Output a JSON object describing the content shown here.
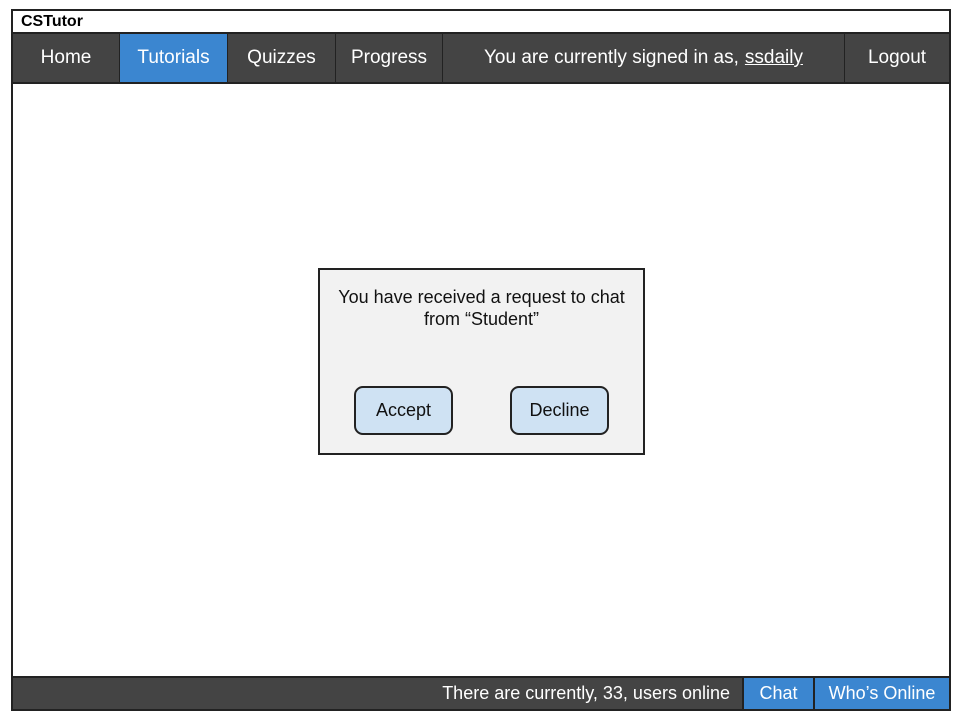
{
  "app": {
    "title": "CSTutor"
  },
  "nav": {
    "items": [
      {
        "label": "Home"
      },
      {
        "label": "Tutorials",
        "active": true
      },
      {
        "label": "Quizzes"
      },
      {
        "label": "Progress"
      }
    ],
    "signed_in_prefix": "You are currently signed in as,",
    "username": "ssdaily",
    "logout_label": "Logout"
  },
  "dialog": {
    "message": "You have received a request to chat from “Student”",
    "accept_label": "Accept",
    "decline_label": "Decline"
  },
  "footer": {
    "status_text": "There are currently, 33, users online",
    "chat_label": "Chat",
    "whos_online_label": "Who’s Online"
  },
  "colors": {
    "nav_background": "#444444",
    "active_accent": "#3b86d0",
    "button_fill": "#cfe2f3",
    "dialog_background": "#f2f2f2"
  }
}
